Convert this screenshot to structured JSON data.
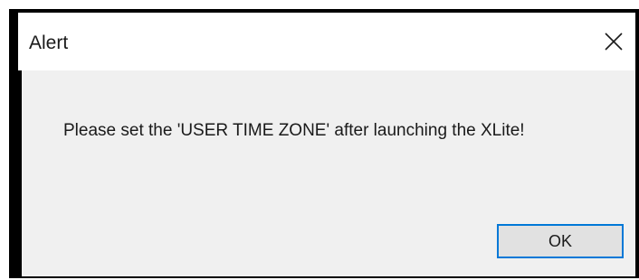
{
  "window": {
    "title": "Alert",
    "close_icon": "close-icon"
  },
  "message": {
    "text": "Please set the 'USER TIME ZONE' after launching the XLite!"
  },
  "buttons": {
    "ok_label": "OK"
  },
  "colors": {
    "accent": "#0078d7",
    "dialog_bg": "#f0f0f0",
    "titlebar_bg": "#ffffff",
    "frame": "#000000"
  }
}
